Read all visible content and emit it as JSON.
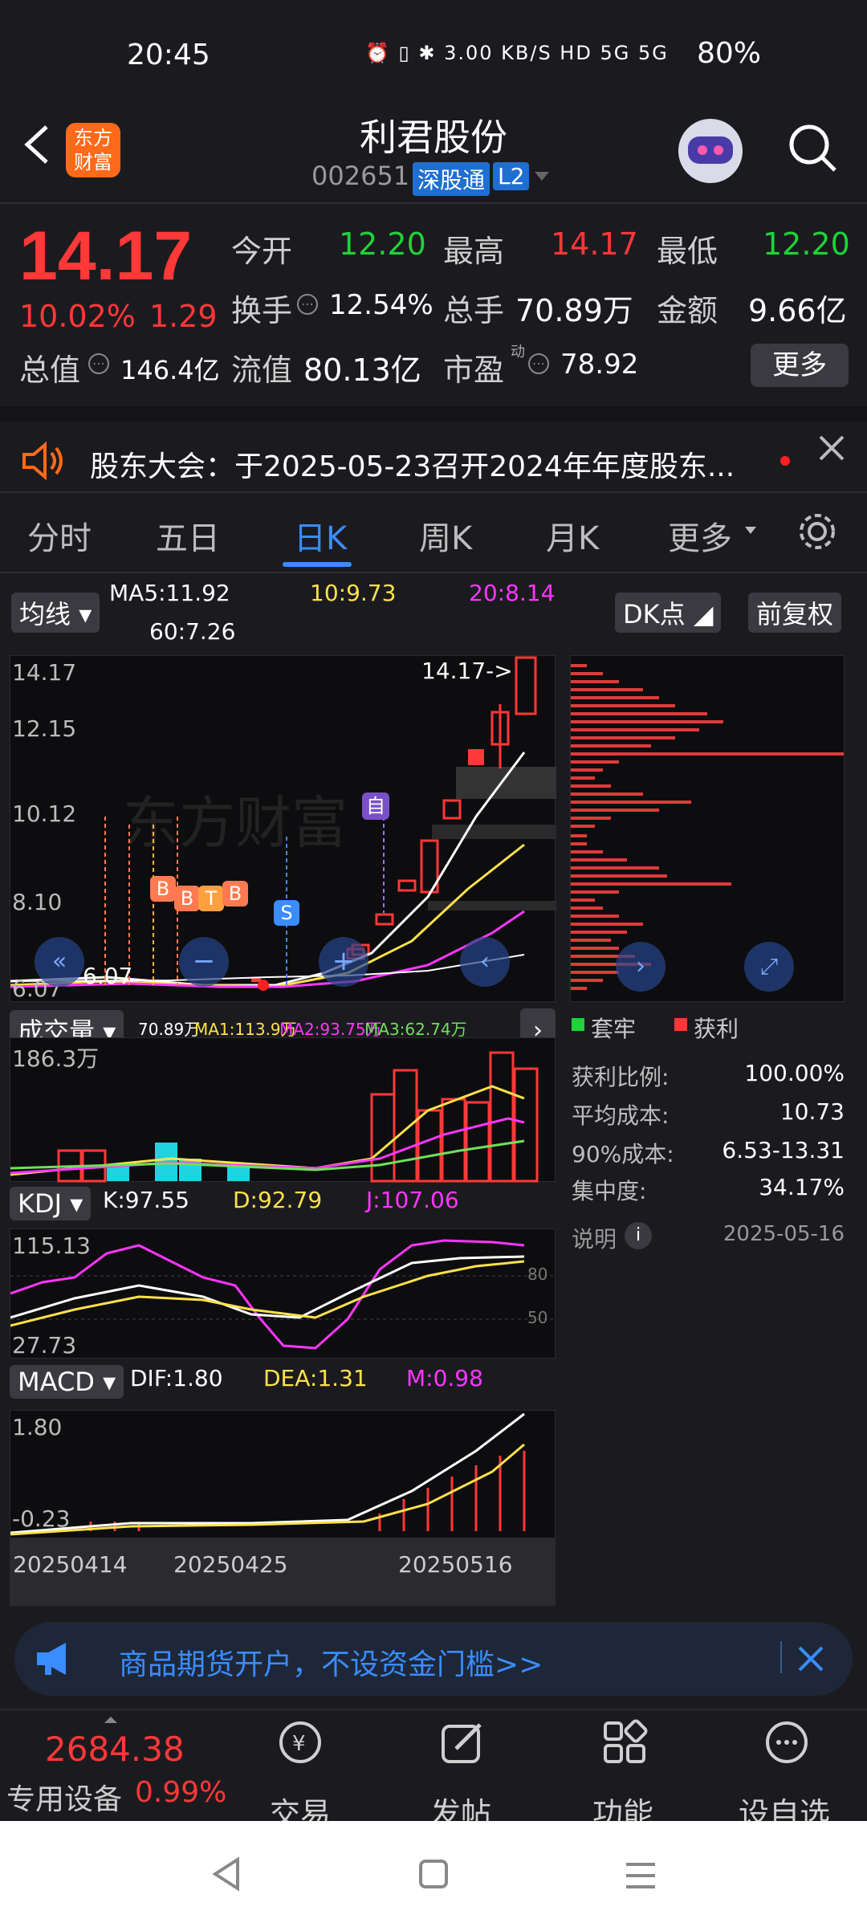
{
  "status_bar": {
    "time": "20:45",
    "icons": "⏰ ▯ ✱ 3.00 KB/S HD 5G 5G",
    "battery": "80%"
  },
  "header": {
    "title": "利君股份",
    "code": "002651",
    "tag_szt": "深股通",
    "tag_l2": "L2",
    "logo_text": "东方财富"
  },
  "quote": {
    "price": "14.17",
    "change_pct": "10.02%",
    "change_abs": "1.29",
    "open_label": "今开",
    "open": "12.20",
    "high_label": "最高",
    "high": "14.17",
    "low_label": "最低",
    "low": "12.20",
    "turnover_label": "换手",
    "turnover": "12.54%",
    "volume_label": "总手",
    "volume": "70.89万",
    "amount_label": "金额",
    "amount": "9.66亿",
    "mktcap_label": "总值",
    "mktcap": "146.4亿",
    "float_label": "流值",
    "float_cap": "80.13亿",
    "pe_label": "市盈",
    "pe_sup": "动",
    "pe": "78.92",
    "more": "更多"
  },
  "notice": {
    "text": "股东大会：于2025-05-23召开2024年年度股东..."
  },
  "tabs": [
    "分时",
    "五日",
    "日K",
    "周K",
    "月K",
    "更多"
  ],
  "kline": {
    "ma_selector": "均线",
    "ma5": "MA5:11.92",
    "ma10": "10:9.73",
    "ma20": "20:8.14",
    "ma60": "60:7.26",
    "dk_btn": "DK点",
    "fq_btn": "前复权",
    "y_labels": [
      "14.17",
      "12.15",
      "10.12",
      "8.10",
      "6.07"
    ],
    "last_label": "14.17->",
    "low_label": "6.07",
    "zi_tag": "自",
    "signal_tags": [
      "B",
      "B",
      "T",
      "B",
      "S"
    ],
    "watermark": "东方财富"
  },
  "volume": {
    "selector": "成交量",
    "vol": "70.89万",
    "ma1": "MA1:113.9万",
    "ma2": "MA2:93.75万",
    "ma3": "MA3:62.74万",
    "ymax": "186.3万"
  },
  "kdj": {
    "selector": "KDJ",
    "k": "K:97.55",
    "d": "D:92.79",
    "j": "J:107.06",
    "ymax": "115.13",
    "ymin": "27.73",
    "l80": "80",
    "l50": "50"
  },
  "macd": {
    "selector": "MACD",
    "dif": "DIF:1.80",
    "dea": "DEA:1.31",
    "m": "M:0.98",
    "ymax": "1.80",
    "ymin": "-0.23",
    "dates": [
      "20250414",
      "20250425",
      "20250516"
    ]
  },
  "chip": {
    "legend_trapped": "套牢",
    "legend_profit": "获利",
    "rows": [
      {
        "label": "获利比例:",
        "value": "100.00%"
      },
      {
        "label": "平均成本:",
        "value": "10.73"
      },
      {
        "label": "90%成本:",
        "value": "6.53-13.31"
      },
      {
        "label": "集中度:",
        "value": "34.17%"
      }
    ],
    "note_label": "说明",
    "date": "2025-05-16"
  },
  "ad": {
    "text": "商品期货开户，不设资金门槛>>"
  },
  "bottom_nav": {
    "index_value": "2684.38",
    "index_name": "专用设备",
    "index_pct": "0.99%",
    "items": [
      "交易",
      "发帖",
      "功能",
      "设自选"
    ]
  },
  "colors": {
    "up": "#ff3838",
    "down": "#1fd339",
    "accent": "#3a8cff",
    "ma5": "#ffffff",
    "ma10": "#ffe14a",
    "ma20": "#ff36ff",
    "ma60": "#ffffff"
  }
}
